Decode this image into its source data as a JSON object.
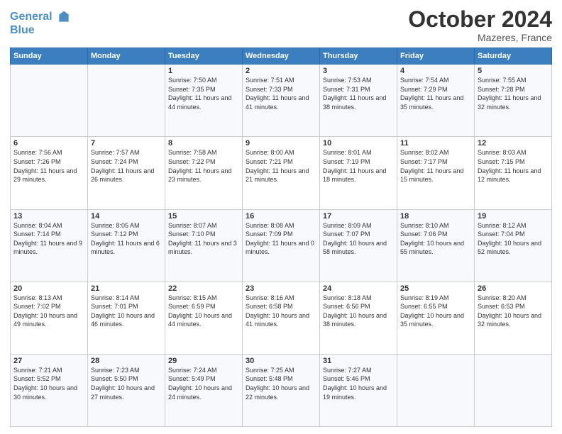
{
  "header": {
    "logo_line1": "General",
    "logo_line2": "Blue",
    "month": "October 2024",
    "location": "Mazeres, France"
  },
  "days_of_week": [
    "Sunday",
    "Monday",
    "Tuesday",
    "Wednesday",
    "Thursday",
    "Friday",
    "Saturday"
  ],
  "weeks": [
    [
      {
        "day": "",
        "info": ""
      },
      {
        "day": "",
        "info": ""
      },
      {
        "day": "1",
        "info": "Sunrise: 7:50 AM\nSunset: 7:35 PM\nDaylight: 11 hours and 44 minutes."
      },
      {
        "day": "2",
        "info": "Sunrise: 7:51 AM\nSunset: 7:33 PM\nDaylight: 11 hours and 41 minutes."
      },
      {
        "day": "3",
        "info": "Sunrise: 7:53 AM\nSunset: 7:31 PM\nDaylight: 11 hours and 38 minutes."
      },
      {
        "day": "4",
        "info": "Sunrise: 7:54 AM\nSunset: 7:29 PM\nDaylight: 11 hours and 35 minutes."
      },
      {
        "day": "5",
        "info": "Sunrise: 7:55 AM\nSunset: 7:28 PM\nDaylight: 11 hours and 32 minutes."
      }
    ],
    [
      {
        "day": "6",
        "info": "Sunrise: 7:56 AM\nSunset: 7:26 PM\nDaylight: 11 hours and 29 minutes."
      },
      {
        "day": "7",
        "info": "Sunrise: 7:57 AM\nSunset: 7:24 PM\nDaylight: 11 hours and 26 minutes."
      },
      {
        "day": "8",
        "info": "Sunrise: 7:58 AM\nSunset: 7:22 PM\nDaylight: 11 hours and 23 minutes."
      },
      {
        "day": "9",
        "info": "Sunrise: 8:00 AM\nSunset: 7:21 PM\nDaylight: 11 hours and 21 minutes."
      },
      {
        "day": "10",
        "info": "Sunrise: 8:01 AM\nSunset: 7:19 PM\nDaylight: 11 hours and 18 minutes."
      },
      {
        "day": "11",
        "info": "Sunrise: 8:02 AM\nSunset: 7:17 PM\nDaylight: 11 hours and 15 minutes."
      },
      {
        "day": "12",
        "info": "Sunrise: 8:03 AM\nSunset: 7:15 PM\nDaylight: 11 hours and 12 minutes."
      }
    ],
    [
      {
        "day": "13",
        "info": "Sunrise: 8:04 AM\nSunset: 7:14 PM\nDaylight: 11 hours and 9 minutes."
      },
      {
        "day": "14",
        "info": "Sunrise: 8:05 AM\nSunset: 7:12 PM\nDaylight: 11 hours and 6 minutes."
      },
      {
        "day": "15",
        "info": "Sunrise: 8:07 AM\nSunset: 7:10 PM\nDaylight: 11 hours and 3 minutes."
      },
      {
        "day": "16",
        "info": "Sunrise: 8:08 AM\nSunset: 7:09 PM\nDaylight: 11 hours and 0 minutes."
      },
      {
        "day": "17",
        "info": "Sunrise: 8:09 AM\nSunset: 7:07 PM\nDaylight: 10 hours and 58 minutes."
      },
      {
        "day": "18",
        "info": "Sunrise: 8:10 AM\nSunset: 7:06 PM\nDaylight: 10 hours and 55 minutes."
      },
      {
        "day": "19",
        "info": "Sunrise: 8:12 AM\nSunset: 7:04 PM\nDaylight: 10 hours and 52 minutes."
      }
    ],
    [
      {
        "day": "20",
        "info": "Sunrise: 8:13 AM\nSunset: 7:02 PM\nDaylight: 10 hours and 49 minutes."
      },
      {
        "day": "21",
        "info": "Sunrise: 8:14 AM\nSunset: 7:01 PM\nDaylight: 10 hours and 46 minutes."
      },
      {
        "day": "22",
        "info": "Sunrise: 8:15 AM\nSunset: 6:59 PM\nDaylight: 10 hours and 44 minutes."
      },
      {
        "day": "23",
        "info": "Sunrise: 8:16 AM\nSunset: 6:58 PM\nDaylight: 10 hours and 41 minutes."
      },
      {
        "day": "24",
        "info": "Sunrise: 8:18 AM\nSunset: 6:56 PM\nDaylight: 10 hours and 38 minutes."
      },
      {
        "day": "25",
        "info": "Sunrise: 8:19 AM\nSunset: 6:55 PM\nDaylight: 10 hours and 35 minutes."
      },
      {
        "day": "26",
        "info": "Sunrise: 8:20 AM\nSunset: 6:53 PM\nDaylight: 10 hours and 32 minutes."
      }
    ],
    [
      {
        "day": "27",
        "info": "Sunrise: 7:21 AM\nSunset: 5:52 PM\nDaylight: 10 hours and 30 minutes."
      },
      {
        "day": "28",
        "info": "Sunrise: 7:23 AM\nSunset: 5:50 PM\nDaylight: 10 hours and 27 minutes."
      },
      {
        "day": "29",
        "info": "Sunrise: 7:24 AM\nSunset: 5:49 PM\nDaylight: 10 hours and 24 minutes."
      },
      {
        "day": "30",
        "info": "Sunrise: 7:25 AM\nSunset: 5:48 PM\nDaylight: 10 hours and 22 minutes."
      },
      {
        "day": "31",
        "info": "Sunrise: 7:27 AM\nSunset: 5:46 PM\nDaylight: 10 hours and 19 minutes."
      },
      {
        "day": "",
        "info": ""
      },
      {
        "day": "",
        "info": ""
      }
    ]
  ]
}
